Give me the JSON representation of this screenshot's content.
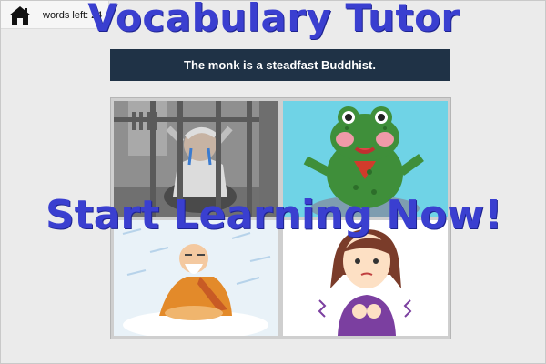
{
  "app": {
    "title": "Vocabulary Tutor",
    "words_left": "words left: 24"
  },
  "quiz": {
    "sentence": "The monk is a steadfast Buddhist.",
    "choices": [
      {
        "icon": "prisoner-crying-image"
      },
      {
        "icon": "frog-creature-image"
      },
      {
        "icon": "monk-meditating-snow-image"
      },
      {
        "icon": "worried-girl-image"
      }
    ]
  },
  "cta": {
    "label": "Start Learning Now!"
  },
  "colors": {
    "title": "#3a3fd0",
    "sentence_bg": "#1f3246"
  }
}
